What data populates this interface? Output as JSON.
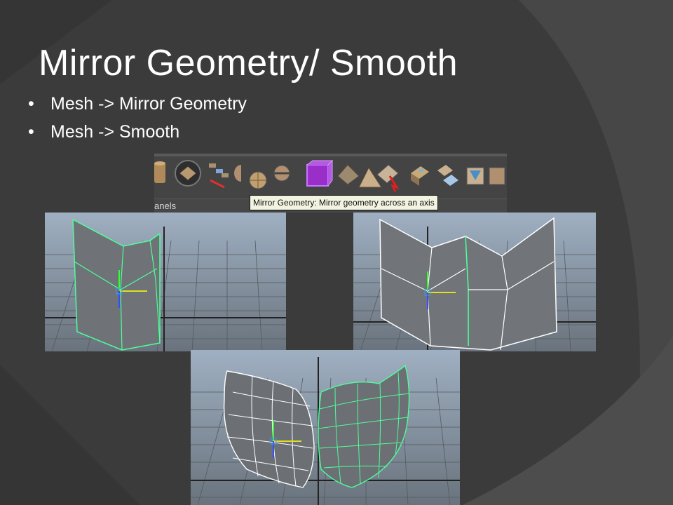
{
  "slide": {
    "title": "Mirror Geometry/ Smooth",
    "bullets": [
      {
        "marker": "•",
        "text": "Mesh -> Mirror Geometry"
      },
      {
        "marker": "•",
        "text": "Mesh -> Smooth"
      }
    ]
  },
  "toolbar": {
    "panels_label": "anels",
    "tooltip": "Mirror Geometry: Mirror geometry across an axis",
    "icons": [
      "cylinder-icon",
      "sculpt-icon",
      "move-uv-icon",
      "sphere-half-icon",
      "sphere-icon",
      "sphere-split-icon",
      "mirror-cube-icon",
      "plane-grid-icon",
      "pyramid-icon",
      "extract-icon",
      "cube-face-icon",
      "uv-planes-icon",
      "cone-cube-icon"
    ]
  },
  "viewports": [
    {
      "name": "half-mesh-viewport"
    },
    {
      "name": "mirrored-mesh-viewport"
    },
    {
      "name": "smoothed-mesh-viewport"
    }
  ],
  "colors": {
    "background": "#3c3c3c",
    "text": "#ffffff",
    "viewport_sky": "#8fa3b8",
    "mesh_edge": "#4dff9a",
    "tooltip_bg": "#f3f3e1"
  }
}
